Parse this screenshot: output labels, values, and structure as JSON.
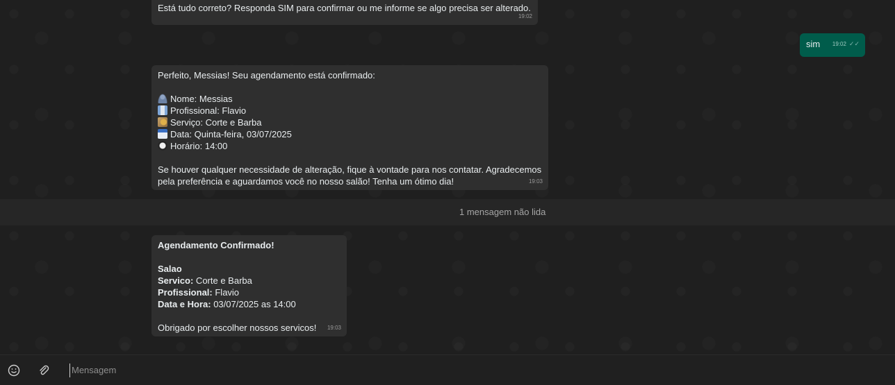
{
  "messages": {
    "m1": {
      "text": "Está tudo correto? Responda SIM para confirmar ou me informe se algo precisa ser alterado.",
      "time": "19:02"
    },
    "m2": {
      "text": "sim",
      "time": "19:02"
    },
    "m3": {
      "intro": "Perfeito, Messias! Seu agendamento está confirmado:",
      "nome": "Nome: Messias",
      "profissional": "Profissional: Flavio",
      "servico": "Serviço: Corte e Barba",
      "data": "Data: Quinta-feira, 03/07/2025",
      "horario": "Horário: 14:00",
      "outro1": "Se houver qualquer necessidade de alteração, fique à vontade para nos contatar. Agradecemos",
      "outro2": "pela preferência e aguardamos você no nosso salão! Tenha um ótimo dia!",
      "time": "19:03"
    },
    "m4": {
      "title": "Agendamento Confirmado!",
      "salao": "Salao",
      "servico_label": "Servico:",
      "servico_value": " Corte e Barba",
      "profissional_label": "Profissional:",
      "profissional_value": " Flavio",
      "datahora_label": "Data e Hora:",
      "datahora_value": " 03/07/2025 as 14:00",
      "thanks": "Obrigado por escolher nossos servicos!",
      "time": "19:03"
    }
  },
  "unread": "1 mensagem não lida",
  "composer": {
    "placeholder": "Mensagem",
    "emoji_icon": "emoji-icon",
    "attach_icon": "paperclip-icon"
  },
  "colors": {
    "incoming_bubble": "#2f2f2f",
    "outgoing_bubble": "#005c4b",
    "background": "#1f1f1f"
  }
}
